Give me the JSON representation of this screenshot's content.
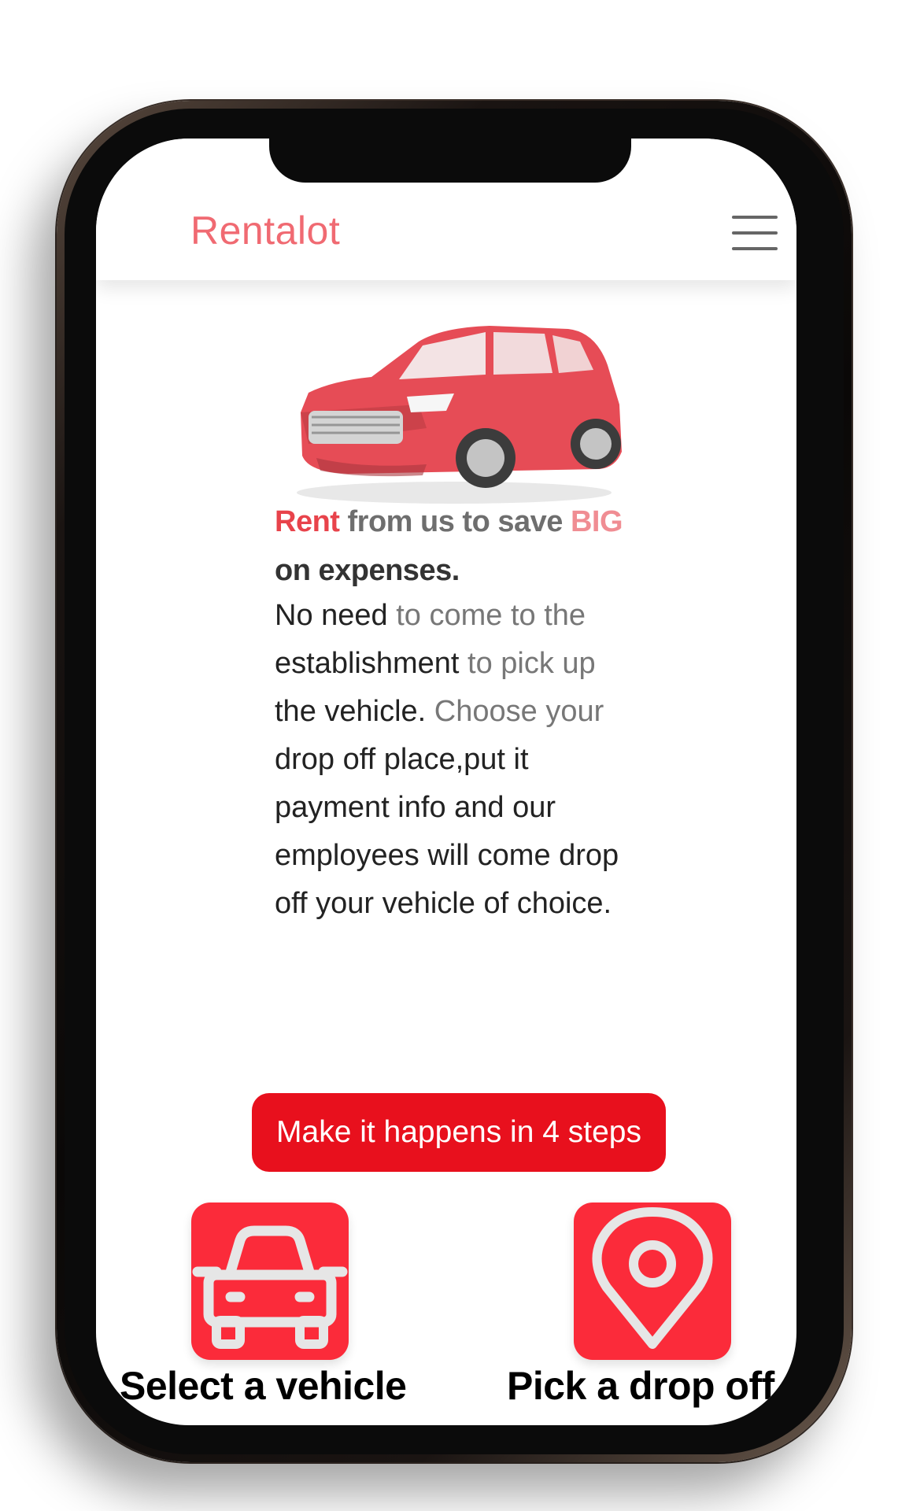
{
  "header": {
    "brand": "Rentalot",
    "menu_icon": "hamburger-menu-icon"
  },
  "hero": {
    "image_icon": "red-suv-image",
    "headline_parts": [
      "Rent",
      " from us to save ",
      "BIG",
      " on expenses."
    ],
    "body_parts": [
      "No need ",
      "to come to the",
      " establishment",
      " to pick up",
      " the vehicle.",
      " Choose your",
      " drop off place,put it payment info and our employees will come drop off your vehicle of choice."
    ]
  },
  "cta": {
    "label": "Make it happens in 4 steps"
  },
  "steps": [
    {
      "icon": "car-icon",
      "label": "Select a vehicle"
    },
    {
      "icon": "location-pin-icon",
      "label": "Pick a drop off"
    }
  ],
  "colors": {
    "brand": "#f06a72",
    "accent": "#e8101d",
    "icon_bg": "#fb2b3a"
  }
}
